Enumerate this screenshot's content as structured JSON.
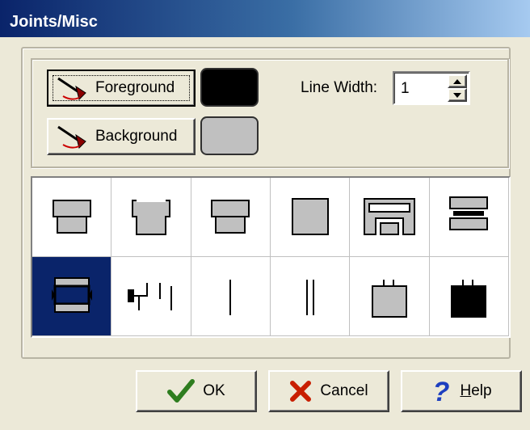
{
  "window": {
    "title": "Joints/Misc"
  },
  "colors": {
    "foreground_swatch": "#000000",
    "background_swatch": "#c0c0c0",
    "selection": "#0a246a",
    "ok_icon": "#2e7d1f",
    "cancel_icon": "#c81e00",
    "help_icon": "#1d3fbf"
  },
  "color_buttons": {
    "foreground": {
      "label": "Foreground",
      "icon": "brush-icon"
    },
    "background": {
      "label": "Background",
      "icon": "brush-icon"
    }
  },
  "line_width": {
    "label": "Line Width:",
    "value": "1"
  },
  "symbols": {
    "selected_row": 2,
    "selected_col": 1,
    "rows": [
      [
        "flared-top-joint-icon",
        "tapered-joint-icon",
        "top-cap-joint-icon",
        "square-joint-icon",
        "interlock-joint-icon",
        "stacked-bar-joint-icon"
      ],
      [
        "bracket-joint-icon",
        "step-line-symbol-icon",
        "single-line-symbol-icon",
        "double-line-symbol-icon",
        "gray-box-tabs-icon",
        "black-box-tabs-icon"
      ]
    ]
  },
  "buttons": {
    "ok": {
      "label": "OK",
      "icon": "checkmark-icon"
    },
    "cancel": {
      "label": "Cancel",
      "icon": "x-icon"
    },
    "help": {
      "label_underlined": "H",
      "label_rest": "elp",
      "icon": "question-icon"
    }
  }
}
